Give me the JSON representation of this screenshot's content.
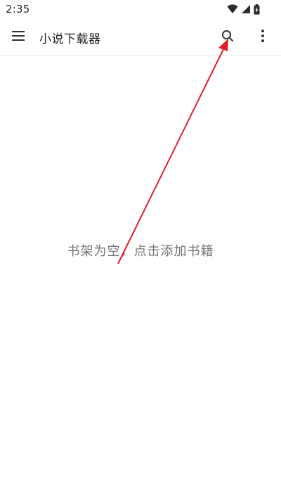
{
  "status_bar": {
    "time": "2:35",
    "icons": [
      "wifi-icon",
      "cellular-signal-icon",
      "battery-charging-icon"
    ]
  },
  "app_bar": {
    "title": "小说下载器",
    "menu_icon": "hamburger-menu-icon",
    "search_icon": "search-icon",
    "overflow_icon": "more-vert-icon"
  },
  "shelf": {
    "empty_message": "书架为空，点击添加书籍"
  },
  "annotation": {
    "type": "arrow",
    "color": "#e0202b",
    "target": "search-button"
  }
}
